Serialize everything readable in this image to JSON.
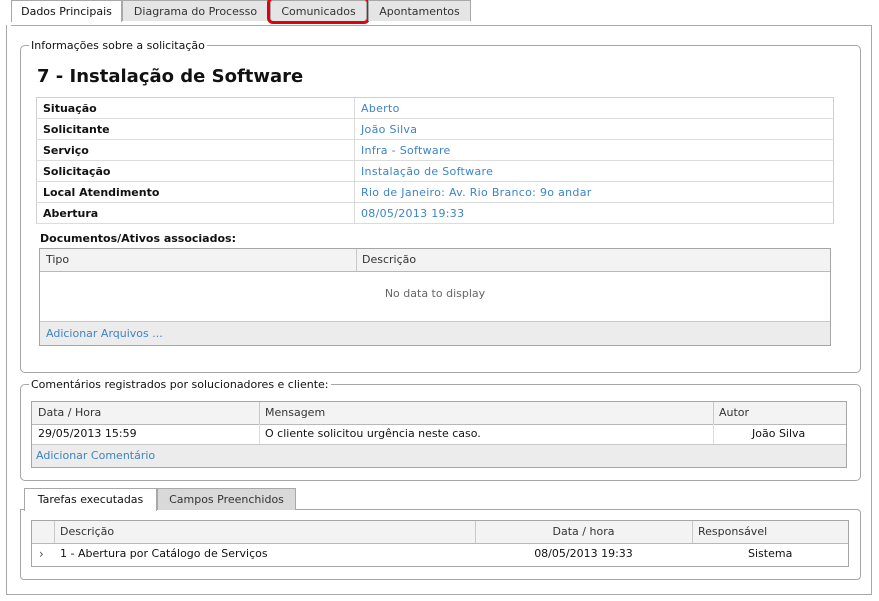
{
  "top_tabs": {
    "dados": "Dados Principais",
    "diagrama": "Diagrama do Processo",
    "comunicados": "Comunicados",
    "apontamentos": "Apontamentos"
  },
  "info_section": {
    "legend": "Informações sobre a solicitação",
    "title": "7 - Instalação de Software",
    "rows": [
      {
        "label": "Situação",
        "value": "Aberto"
      },
      {
        "label": "Solicitante",
        "value": "João Silva"
      },
      {
        "label": "Serviço",
        "value": "Infra - Software"
      },
      {
        "label": "Solicitação",
        "value": "Instalação de Software"
      },
      {
        "label": "Local Atendimento",
        "value": "Rio de Janeiro: Av. Rio Branco: 9o andar"
      },
      {
        "label": "Abertura",
        "value": "08/05/2013 19:33"
      }
    ],
    "docs_label": "Documentos/Ativos associados:",
    "docs_columns": [
      "Tipo",
      "Descrição"
    ],
    "docs_empty": "No data to display",
    "docs_add": "Adicionar Arquivos ..."
  },
  "comments_section": {
    "legend": "Comentários registrados por solucionadores e cliente:",
    "columns": [
      "Data / Hora",
      "Mensagem",
      "Autor"
    ],
    "rows": [
      {
        "date": "29/05/2013 15:59",
        "message": "O cliente solicitou urgência neste caso.",
        "author": "João Silva"
      }
    ],
    "add": "Adicionar Comentário"
  },
  "tasks_section": {
    "tabs": [
      "Tarefas executadas",
      "Campos Preenchidos"
    ],
    "columns": [
      "Descrição",
      "Data / hora",
      "Responsável"
    ],
    "rows": [
      {
        "expander": "›",
        "desc": "1 - Abertura por Catálogo de Serviços",
        "date": "08/05/2013 19:33",
        "resp": "Sistema"
      }
    ]
  },
  "colors": {
    "link": "#3d84c6",
    "highlight": "#e0000f"
  }
}
